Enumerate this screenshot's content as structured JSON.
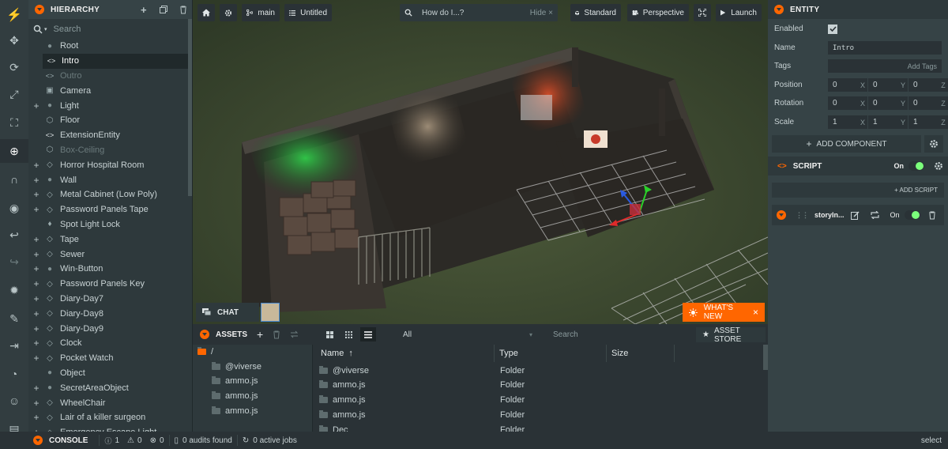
{
  "toolbar": {
    "icons": [
      "logo-icon",
      "move-icon",
      "rotate-icon",
      "scale-icon",
      "resize-icon",
      "world-icon",
      "magnet-icon",
      "eye-icon",
      "undo-icon",
      "redo-icon",
      "light-icon",
      "edit-icon",
      "enter-icon",
      "github-icon",
      "discord-icon",
      "chat-icon"
    ]
  },
  "hierarchy": {
    "title": "HIERARCHY",
    "search_placeholder": "Search",
    "items": [
      {
        "label": "Root",
        "plus": false,
        "icon": "circle",
        "indent": 0,
        "dim": false,
        "selected": false
      },
      {
        "label": "Intro",
        "plus": false,
        "icon": "code",
        "indent": 1,
        "dim": false,
        "selected": true
      },
      {
        "label": "Outro",
        "plus": false,
        "icon": "code",
        "indent": 1,
        "dim": true,
        "selected": false
      },
      {
        "label": "Camera",
        "plus": false,
        "icon": "camera",
        "indent": 1,
        "dim": false,
        "selected": false
      },
      {
        "label": "Light",
        "plus": true,
        "icon": "circle",
        "indent": 1,
        "dim": false,
        "selected": false
      },
      {
        "label": "Floor",
        "plus": false,
        "icon": "hex",
        "indent": 1,
        "dim": false,
        "selected": false
      },
      {
        "label": "ExtensionEntity",
        "plus": false,
        "icon": "code",
        "indent": 1,
        "dim": false,
        "selected": false
      },
      {
        "label": "Box-Ceiling",
        "plus": false,
        "icon": "hex",
        "indent": 1,
        "dim": true,
        "selected": false
      },
      {
        "label": "Horror Hospital Room",
        "plus": true,
        "icon": "diamond",
        "indent": 1,
        "dim": false,
        "selected": false
      },
      {
        "label": "Wall",
        "plus": true,
        "icon": "circle",
        "indent": 1,
        "dim": false,
        "selected": false
      },
      {
        "label": "Metal Cabinet (Low Poly)",
        "plus": true,
        "icon": "diamond",
        "indent": 1,
        "dim": false,
        "selected": false
      },
      {
        "label": "Password Panels Tape",
        "plus": true,
        "icon": "diamond",
        "indent": 1,
        "dim": false,
        "selected": false
      },
      {
        "label": "Spot Light Lock",
        "plus": false,
        "icon": "bulb",
        "indent": 1,
        "dim": false,
        "selected": false
      },
      {
        "label": "Tape",
        "plus": true,
        "icon": "diamond",
        "indent": 1,
        "dim": false,
        "selected": false
      },
      {
        "label": "Sewer",
        "plus": true,
        "icon": "diamond",
        "indent": 1,
        "dim": false,
        "selected": false
      },
      {
        "label": "Win-Button",
        "plus": true,
        "icon": "circle",
        "indent": 1,
        "dim": false,
        "selected": false
      },
      {
        "label": "Password Panels Key",
        "plus": true,
        "icon": "diamond",
        "indent": 1,
        "dim": false,
        "selected": false
      },
      {
        "label": "Diary-Day7",
        "plus": true,
        "icon": "diamond",
        "indent": 1,
        "dim": false,
        "selected": false
      },
      {
        "label": "Diary-Day8",
        "plus": true,
        "icon": "diamond",
        "indent": 1,
        "dim": false,
        "selected": false
      },
      {
        "label": "Diary-Day9",
        "plus": true,
        "icon": "diamond",
        "indent": 1,
        "dim": false,
        "selected": false
      },
      {
        "label": "Clock",
        "plus": true,
        "icon": "diamond",
        "indent": 1,
        "dim": false,
        "selected": false
      },
      {
        "label": "Pocket Watch",
        "plus": true,
        "icon": "diamond",
        "indent": 1,
        "dim": false,
        "selected": false
      },
      {
        "label": "Object",
        "plus": false,
        "icon": "circle",
        "indent": 1,
        "dim": false,
        "selected": false
      },
      {
        "label": "SecretAreaObject",
        "plus": true,
        "icon": "circle",
        "indent": 1,
        "dim": false,
        "selected": false
      },
      {
        "label": "WheelChair",
        "plus": true,
        "icon": "diamond",
        "indent": 1,
        "dim": false,
        "selected": false
      },
      {
        "label": "Lair of a killer surgeon",
        "plus": true,
        "icon": "diamond",
        "indent": 1,
        "dim": false,
        "selected": false
      },
      {
        "label": "Emergency Escape Light",
        "plus": true,
        "icon": "diamond",
        "indent": 1,
        "dim": false,
        "selected": false
      }
    ]
  },
  "viewport_toolbar": {
    "branch": "main",
    "scene": "Untitled",
    "search_text": "How do I...?",
    "hide_label": "Hide",
    "standard_label": "Standard",
    "perspective_label": "Perspective",
    "launch_label": "Launch"
  },
  "viewport": {
    "chat_label": "CHAT",
    "whats_new_label": "WHAT'S NEW",
    "close_glyph": "×"
  },
  "assets": {
    "title": "ASSETS",
    "filter_value": "All",
    "search_placeholder": "Search",
    "store_label": "ASSET STORE",
    "tree": [
      {
        "label": "/",
        "root": true
      },
      {
        "label": "@viverse",
        "root": false
      },
      {
        "label": "ammo.js",
        "root": false
      },
      {
        "label": "ammo.js",
        "root": false
      },
      {
        "label": "ammo.js",
        "root": false
      }
    ],
    "columns": {
      "name": "Name",
      "type": "Type",
      "size": "Size",
      "sort_glyph": "↑"
    },
    "rows": [
      {
        "name": "@viverse",
        "type": "Folder"
      },
      {
        "name": "ammo.js",
        "type": "Folder"
      },
      {
        "name": "ammo.js",
        "type": "Folder"
      },
      {
        "name": "ammo.js",
        "type": "Folder"
      },
      {
        "name": "Dec",
        "type": "Folder"
      }
    ]
  },
  "inspector": {
    "title": "ENTITY",
    "enabled_label": "Enabled",
    "name_label": "Name",
    "name_value": "Intro",
    "tags_label": "Tags",
    "add_tags_label": "Add Tags",
    "position_label": "Position",
    "rotation_label": "Rotation",
    "scale_label": "Scale",
    "position": [
      "0",
      "0",
      "0"
    ],
    "rotation": [
      "0",
      "0",
      "0"
    ],
    "scale": [
      "1",
      "1",
      "1"
    ],
    "axes": [
      "X",
      "Y",
      "Z"
    ],
    "add_component_label": "ADD COMPONENT",
    "script_title": "SCRIPT",
    "script_on_label": "On",
    "add_script_label": "+ ADD SCRIPT",
    "script_name": "storyIn...",
    "script_item_on_label": "On"
  },
  "status": {
    "console_label": "CONSOLE",
    "info_count": "1",
    "warn_count": "0",
    "error_count": "0",
    "audits_label": "0 audits found",
    "jobs_label": "0 active jobs",
    "select_label": "select"
  }
}
